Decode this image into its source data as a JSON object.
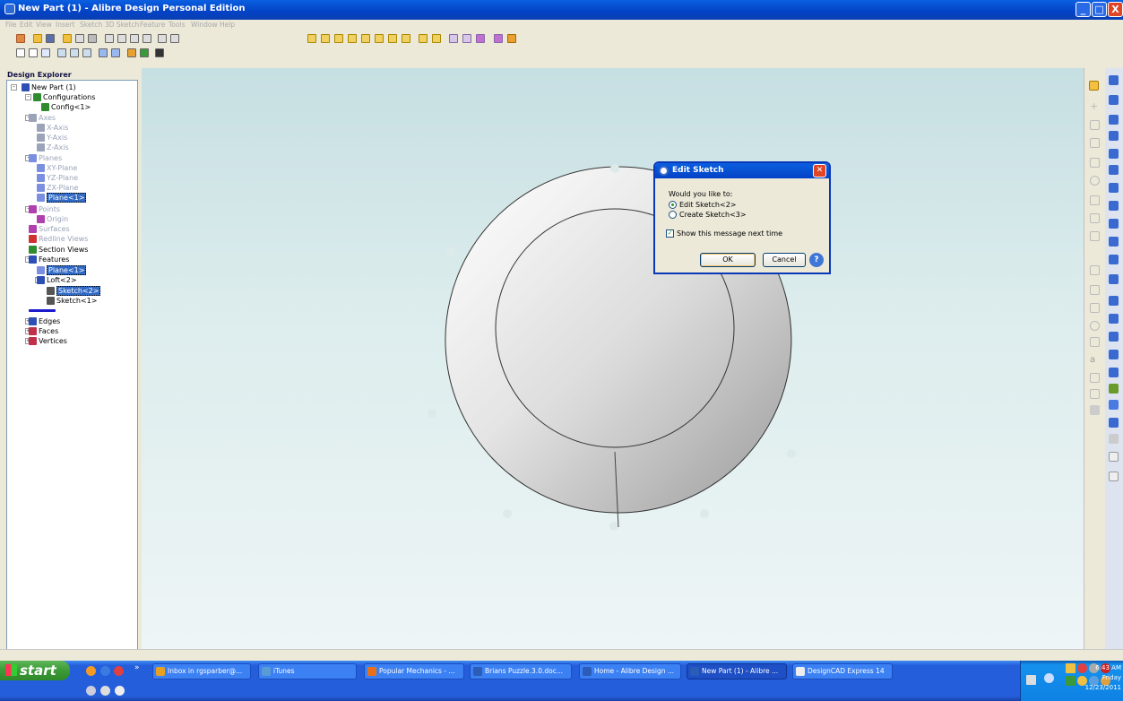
{
  "window": {
    "title": "New Part (1) - Alibre Design Personal Edition",
    "minimize": "_",
    "maximize": "□",
    "close": "X"
  },
  "menu": [
    "File",
    "Edit",
    "View",
    "Insert",
    "Sketch",
    "3D Sketch",
    "Feature",
    "Tools",
    "Window",
    "Help"
  ],
  "explorer": {
    "header": "Design Explorer",
    "items": [
      {
        "label": "New Part (1)",
        "icon": "part-icon",
        "color": "#2d4fb5",
        "dim": false,
        "sel": false
      },
      {
        "label": "Configurations",
        "icon": "configurations-icon",
        "color": "#2e8b2e",
        "dim": false,
        "sel": false
      },
      {
        "label": "Config<1>",
        "icon": "config-icon",
        "color": "#2e8b2e",
        "dim": false,
        "sel": false
      },
      {
        "label": "Axes",
        "icon": "axes-icon",
        "color": "#9aa3b8",
        "dim": true,
        "sel": false
      },
      {
        "label": "X-Axis",
        "icon": "axis-icon",
        "color": "#9aa3b8",
        "dim": true,
        "sel": false
      },
      {
        "label": "Y-Axis",
        "icon": "axis-icon",
        "color": "#9aa3b8",
        "dim": true,
        "sel": false
      },
      {
        "label": "Z-Axis",
        "icon": "axis-icon",
        "color": "#9aa3b8",
        "dim": true,
        "sel": false
      },
      {
        "label": "Planes",
        "icon": "planes-icon",
        "color": "#7b8fe0",
        "dim": true,
        "sel": false
      },
      {
        "label": "XY-Plane",
        "icon": "plane-icon",
        "color": "#7b8fe0",
        "dim": true,
        "sel": false
      },
      {
        "label": "YZ-Plane",
        "icon": "plane-icon",
        "color": "#7b8fe0",
        "dim": true,
        "sel": false
      },
      {
        "label": "ZX-Plane",
        "icon": "plane-icon",
        "color": "#7b8fe0",
        "dim": true,
        "sel": false
      },
      {
        "label": "Plane<1>",
        "icon": "plane-icon",
        "color": "#7b8fe0",
        "dim": false,
        "sel": true
      },
      {
        "label": "Points",
        "icon": "points-icon",
        "color": "#b040b0",
        "dim": true,
        "sel": false
      },
      {
        "label": "Origin",
        "icon": "origin-icon",
        "color": "#b040b0",
        "dim": true,
        "sel": false
      },
      {
        "label": "Surfaces",
        "icon": "surfaces-icon",
        "color": "#b040b0",
        "dim": true,
        "sel": false
      },
      {
        "label": "Redline Views",
        "icon": "redline-views-icon",
        "color": "#d03030",
        "dim": true,
        "sel": false
      },
      {
        "label": "Section Views",
        "icon": "section-views-icon",
        "color": "#2e8b2e",
        "dim": false,
        "sel": false
      },
      {
        "label": "Features",
        "icon": "features-icon",
        "color": "#2d4fb5",
        "dim": false,
        "sel": false
      },
      {
        "label": "Plane<1>",
        "icon": "plane-icon",
        "color": "#7b8fe0",
        "dim": false,
        "sel": true
      },
      {
        "label": "Loft<2>",
        "icon": "loft-icon",
        "color": "#2d4fb5",
        "dim": false,
        "sel": false
      },
      {
        "label": "Sketch<2>",
        "icon": "sketch-icon",
        "color": "#555555",
        "dim": false,
        "sel": true
      },
      {
        "label": "Sketch<1>",
        "icon": "sketch-icon",
        "color": "#555555",
        "dim": false,
        "sel": false
      },
      {
        "label": "",
        "icon": "rollback-bar-icon",
        "color": "#1a1acc",
        "dim": false,
        "sel": false
      },
      {
        "label": "Edges",
        "icon": "edges-icon",
        "color": "#2d4fb5",
        "dim": false,
        "sel": false
      },
      {
        "label": "Faces",
        "icon": "faces-icon",
        "color": "#c0304a",
        "dim": false,
        "sel": false
      },
      {
        "label": "Vertices",
        "icon": "vertices-icon",
        "color": "#c0304a",
        "dim": false,
        "sel": false
      }
    ]
  },
  "dialog": {
    "title": "Edit Sketch",
    "prompt": "Would you like to:",
    "options": [
      {
        "label": "Edit Sketch<2>",
        "selected": true
      },
      {
        "label": "Create Sketch<3>",
        "selected": false
      }
    ],
    "checkbox": {
      "label": "Show this message next time",
      "checked": true
    },
    "ok": "OK",
    "cancel": "Cancel",
    "help": "?"
  },
  "taskbar": {
    "start": "start",
    "chevron": "»",
    "buttons": [
      {
        "label": "Inbox in rgsparber@...",
        "color": "#e8a020",
        "active": false
      },
      {
        "label": "iTunes",
        "color": "#5a9bd5",
        "active": false
      },
      {
        "label": "Popular Mechanics - ...",
        "color": "#e8701a",
        "active": false
      },
      {
        "label": "Brians Puzzle.3.0.doc...",
        "color": "#2a5cb8",
        "active": false
      },
      {
        "label": "Home - Alibre Design ...",
        "color": "#2a5cb8",
        "active": false
      },
      {
        "label": "New Part (1) - Alibre ...",
        "color": "#2a5cb8",
        "active": true
      },
      {
        "label": "DesignCAD Express 14",
        "color": "#eeeeee",
        "active": false
      }
    ],
    "clock": {
      "time": "6:43 AM",
      "day": "Friday",
      "date": "12/23/2011"
    }
  },
  "colors": {
    "accent": "#0a5fe0",
    "viewport_top": "#c6dfe2",
    "part_light": "#f4f4f4",
    "part_dark": "#9a9a9a"
  }
}
